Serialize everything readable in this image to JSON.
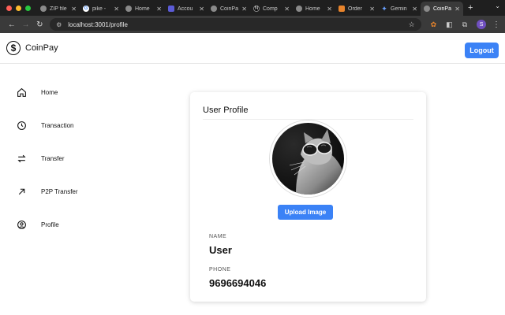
{
  "browser": {
    "tabs": [
      {
        "title": "ZIP file",
        "active": false,
        "icon": "github-icon"
      },
      {
        "title": "pike -",
        "active": false,
        "icon": "google-icon"
      },
      {
        "title": "Home",
        "active": false,
        "icon": "globe-icon"
      },
      {
        "title": "Accou",
        "active": false,
        "icon": "account-icon"
      },
      {
        "title": "CoinPa",
        "active": false,
        "icon": "globe-icon"
      },
      {
        "title": "Comp",
        "active": false,
        "icon": "next-icon"
      },
      {
        "title": "Home",
        "active": false,
        "icon": "globe-icon"
      },
      {
        "title": "Order",
        "active": false,
        "icon": "shield-icon"
      },
      {
        "title": "Gemin",
        "active": false,
        "icon": "gemini-icon"
      },
      {
        "title": "CoinPa",
        "active": true,
        "icon": "globe-icon"
      }
    ],
    "url": "localhost:3001/profile",
    "profile_initial": "S"
  },
  "header": {
    "brand": "CoinPay",
    "logout_label": "Logout"
  },
  "sidebar": {
    "items": [
      {
        "label": "Home",
        "icon": "home-icon"
      },
      {
        "label": "Transaction",
        "icon": "clock-icon"
      },
      {
        "label": "Transfer",
        "icon": "arrows-left-right-icon"
      },
      {
        "label": "P2P Transfer",
        "icon": "arrow-up-right-icon"
      },
      {
        "label": "Profile",
        "icon": "user-circle-icon"
      }
    ]
  },
  "profile": {
    "title": "User Profile",
    "upload_label": "Upload Image",
    "name_label": "NAME",
    "name_value": "User",
    "phone_label": "PHONE",
    "phone_value": "9696694046"
  },
  "colors": {
    "accent": "#3b82f6",
    "chrome_dark": "#1f1f1f",
    "chrome_mid": "#3a3a3a"
  }
}
